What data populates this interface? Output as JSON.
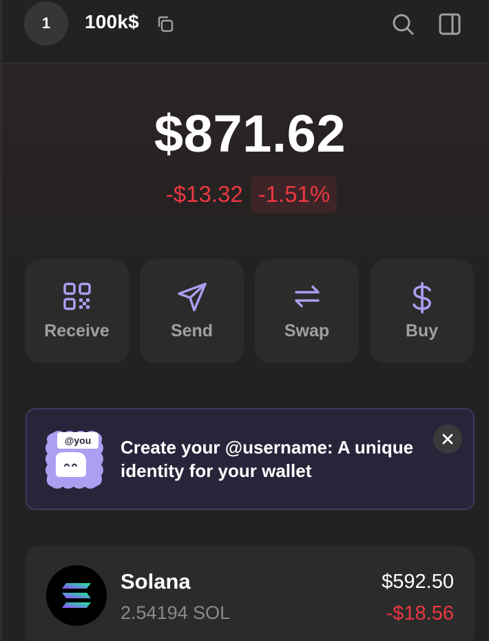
{
  "header": {
    "account_index": "1",
    "account_name": "100k$",
    "icons": [
      "copy-icon",
      "search-icon",
      "side-panel-icon"
    ]
  },
  "portfolio": {
    "balance": "$871.62",
    "change_amount": "-$13.32",
    "change_percent": "-1.51%"
  },
  "actions": [
    {
      "label": "Receive",
      "icon": "qr-code-icon"
    },
    {
      "label": "Send",
      "icon": "send-icon"
    },
    {
      "label": "Swap",
      "icon": "swap-icon"
    },
    {
      "label": "Buy",
      "icon": "dollar-icon"
    }
  ],
  "banner": {
    "tag": "@you",
    "text": "Create your @username: A unique identity for your wallet"
  },
  "tokens": [
    {
      "name": "Solana",
      "amount": "2.54194 SOL",
      "value": "$592.50",
      "change": "-$18.56"
    }
  ],
  "colors": {
    "background": "#222222",
    "card": "#2b2b2b",
    "accent_purple": "#ab9ff2",
    "negative": "#eb3742",
    "muted_text": "#a0a0a0"
  }
}
